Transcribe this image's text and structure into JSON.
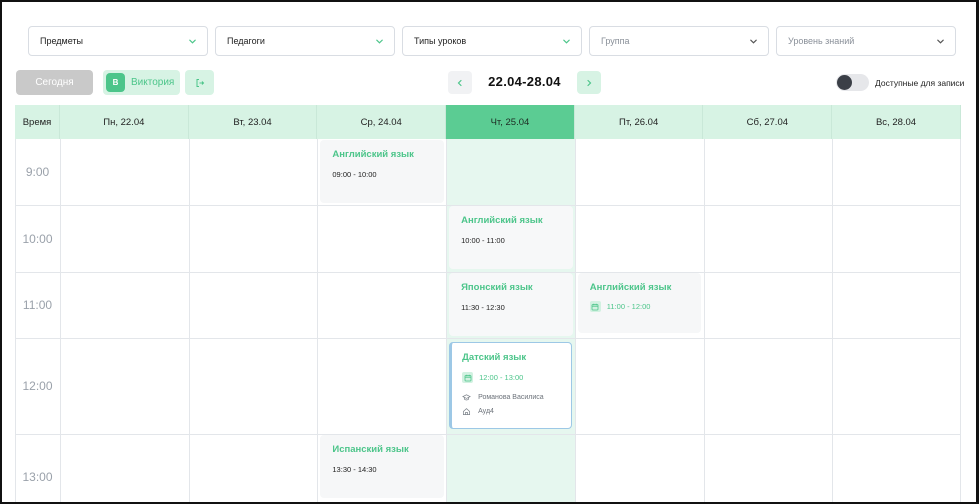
{
  "filters": [
    {
      "label": "Предметы",
      "placeholder": false
    },
    {
      "label": "Педагоги",
      "placeholder": false
    },
    {
      "label": "Типы уроков",
      "placeholder": false
    },
    {
      "label": "Группа",
      "placeholder": true
    },
    {
      "label": "Уровень знаний",
      "placeholder": true
    }
  ],
  "toolbar": {
    "today_label": "Сегодня",
    "user_initial": "В",
    "user_name": "Виктория",
    "week_range": "22.04-28.04",
    "available_label": "Доступные для записи",
    "available_on": false
  },
  "grid": {
    "time_header": "Время",
    "days": [
      "Пн, 22.04",
      "Вт, 23.04",
      "Ср, 24.04",
      "Чт, 25.04",
      "Пт, 26.04",
      "Сб, 27.04",
      "Вс, 28.04"
    ],
    "today_index": 3,
    "times": [
      "9:00",
      "10:00",
      "11:00",
      "12:00",
      "13:00"
    ]
  },
  "lessons": [
    {
      "title": "Английский язык",
      "time": "09:00 - 10:00",
      "day": 2,
      "slot": 0
    },
    {
      "title": "Английский язык",
      "time": "10:00 - 11:00",
      "day": 3,
      "slot": 1
    },
    {
      "title": "Японский язык",
      "time": "11:30 - 12:30",
      "day": 3,
      "slot": 2
    },
    {
      "title": "Английский язык",
      "time": "11:00 - 12:00",
      "day": 4,
      "slot": 2
    },
    {
      "title": "Датский язык",
      "time": "12:00 - 13:00",
      "teacher": "Романова Василиса",
      "room": "Ауд4",
      "day": 3,
      "slot": 3
    },
    {
      "title": "Испанский язык",
      "time": "13:30 - 14:30",
      "day": 2,
      "slot": 4
    }
  ],
  "colors": {
    "accent": "#4cc58a",
    "header_bg": "#d7f3e4",
    "today_header": "#5bcc93",
    "today_column": "#e6f7ef",
    "selected_border": "#9dc8e6"
  }
}
